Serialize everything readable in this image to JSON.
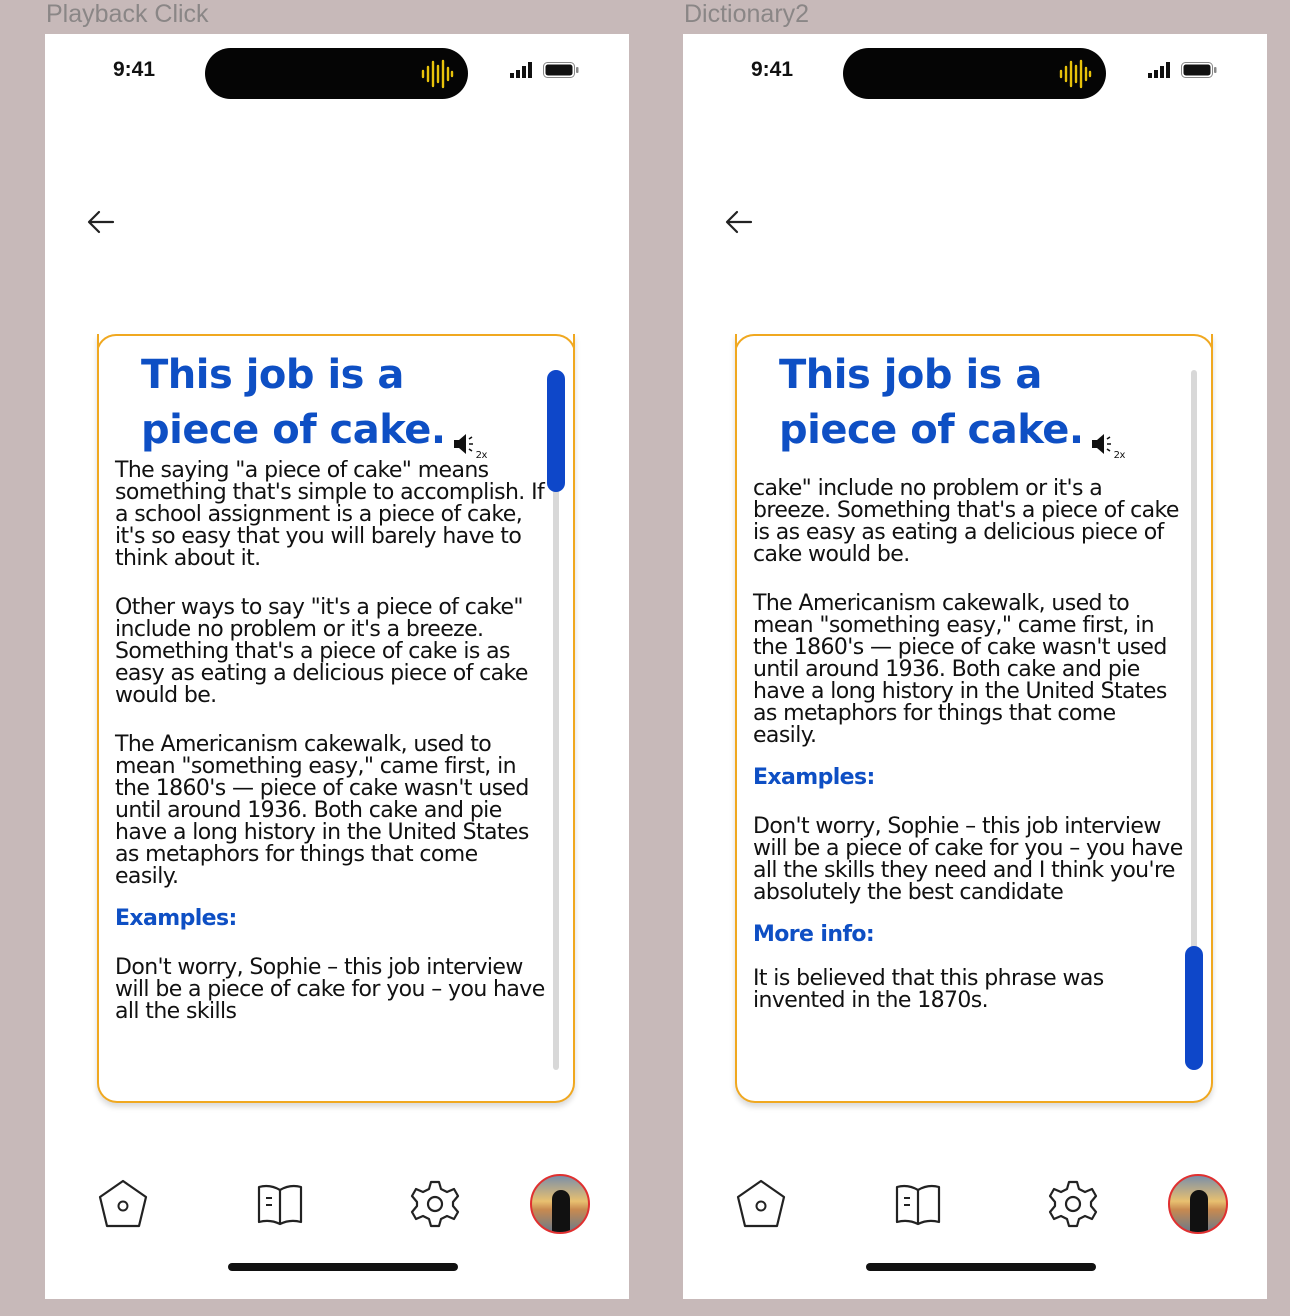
{
  "frames": [
    {
      "label": "Playback Click",
      "time": "9:41",
      "title": "This job is a piece of cake.",
      "speed": "2x",
      "paragraphs": [
        "The saying \"a piece of cake\" means something that's simple to accomplish. If a school assignment is a piece of cake, it's so easy that you will barely have to think about it.",
        "Other ways to say \"it's a piece of cake\" include no problem or it's a breeze. Something that's a piece of cake is as easy as eating a delicious piece of cake would be.",
        "The Americanism cakewalk, used to mean \"something easy,\" came first, in the 1860's — piece of cake wasn't used until around 1936. Both cake and pie have a long history in the United States as metaphors for things that come easily."
      ],
      "examples_heading": "Examples:",
      "example_text": "Don't worry, Sophie – this job interview will be a piece of cake for you – you have all the skills"
    },
    {
      "label": "Dictionary2",
      "time": "9:41",
      "title": "This job is a piece of cake.",
      "speed": "2x",
      "paragraphs": [
        "cake\" include no problem or it's a breeze. Something that's a piece of cake is as easy as eating a delicious piece of cake would be.",
        "The Americanism cakewalk, used to mean \"something easy,\" came first, in the 1860's — piece of cake wasn't used until around 1936. Both cake and pie have a long history in the United States as metaphors for things that come easily."
      ],
      "examples_heading": "Examples:",
      "example_text": "Don't worry, Sophie – this job interview will be a piece of cake for you – you have all the skills they need and I think you're absolutely the best candidate",
      "more_info_heading": "More info:",
      "more_info_text": "It is believed that this phrase was invented in the 1870s."
    }
  ],
  "scroll_position": [
    0.0,
    1.0
  ],
  "nav": [
    "home-icon",
    "book-icon",
    "settings-icon",
    "profile-avatar"
  ],
  "colors": {
    "accent_blue": "#0e4fc4",
    "card_border": "#f0a820",
    "background": "#c7b9b9"
  }
}
